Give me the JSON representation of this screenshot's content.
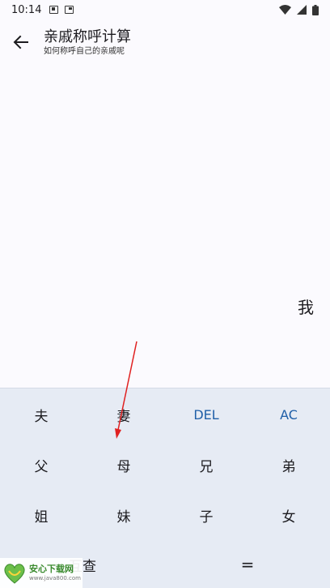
{
  "status_bar": {
    "time": "10:14",
    "icons": [
      "notification-a-icon",
      "notification-box-icon",
      "wifi-icon",
      "signal-icon",
      "battery-icon"
    ]
  },
  "app_bar": {
    "title": "亲戚称呼计算",
    "subtitle": "如何称呼自己的亲戚呢",
    "back_icon": "arrow-back-icon"
  },
  "result": {
    "text": "我"
  },
  "keypad": {
    "keys": [
      {
        "label": "夫",
        "type": "relation"
      },
      {
        "label": "妻",
        "type": "relation"
      },
      {
        "label": "DEL",
        "type": "action"
      },
      {
        "label": "AC",
        "type": "action"
      },
      {
        "label": "父",
        "type": "relation"
      },
      {
        "label": "母",
        "type": "relation"
      },
      {
        "label": "兄",
        "type": "relation"
      },
      {
        "label": "弟",
        "type": "relation"
      },
      {
        "label": "姐",
        "type": "relation"
      },
      {
        "label": "妹",
        "type": "relation"
      },
      {
        "label": "子",
        "type": "relation"
      },
      {
        "label": "女",
        "type": "relation"
      },
      {
        "label": "互查",
        "type": "action"
      },
      {
        "label": "=",
        "type": "action"
      }
    ]
  },
  "watermark": {
    "name": "安心下载网",
    "url": "www.java800.com"
  },
  "colors": {
    "background": "#fbfafe",
    "keypad_background": "#e6ebf4",
    "action_blue": "#1f5fa8",
    "annotation_arrow": "#e02020"
  }
}
